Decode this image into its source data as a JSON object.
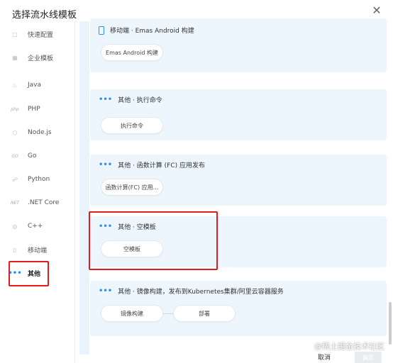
{
  "dialog": {
    "title": "选择流水线模板",
    "close": "✕"
  },
  "sidebar": {
    "items": [
      {
        "icon": "▢",
        "label": "快速配置"
      },
      {
        "icon": "▦",
        "label": "企业模板"
      },
      {
        "icon": "♨",
        "label": "Java"
      },
      {
        "icon": "php",
        "label": "PHP"
      },
      {
        "icon": "⬡",
        "label": "Node.js"
      },
      {
        "icon": "GO",
        "label": "Go"
      },
      {
        "icon": "☍",
        "label": "Python"
      },
      {
        "icon": "NET",
        "label": ".NET Core"
      },
      {
        "icon": "◎",
        "label": "C++"
      },
      {
        "icon": "▯",
        "label": "移动端"
      },
      {
        "icon": "•••",
        "label": "其他"
      }
    ]
  },
  "templates": [
    {
      "title": "移动端 · Emas Android 构建",
      "steps": [
        "Emas Android 构建"
      ]
    },
    {
      "title": "其他 · 执行命令",
      "steps": [
        "执行命令"
      ]
    },
    {
      "title": "其他 · 函数计算 (FC) 应用发布",
      "steps": [
        "函数计算(FC) 应用..."
      ]
    },
    {
      "title": "其他 · 空模板",
      "steps": [
        "空模板"
      ]
    },
    {
      "title": "其他 · 镜像构建，发布到Kubernetes集群/阿里云容器服务",
      "steps": [
        "镜像构建",
        "部署"
      ]
    }
  ],
  "footer": {
    "cancel": "取消",
    "ok": "确定"
  },
  "watermark": "@稀土掘金技术社区",
  "colors": {
    "accent": "#2d8cf0",
    "highlight": "#e01c1c",
    "card_bg": "#edf6fd"
  }
}
